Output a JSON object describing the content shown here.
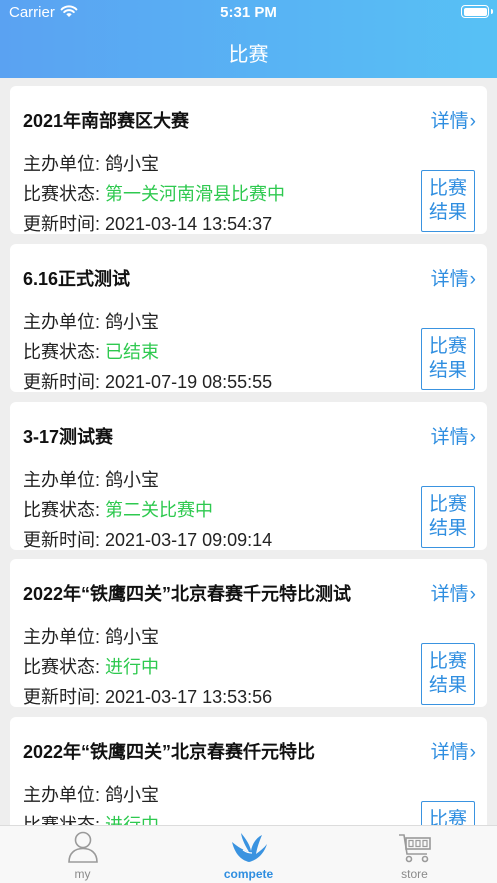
{
  "status_bar": {
    "carrier": "Carrier",
    "time": "5:31 PM"
  },
  "nav": {
    "title": "比赛"
  },
  "labels": {
    "organizer": "主办单位: ",
    "status": "比赛状态: ",
    "updated": "更新时间: ",
    "details": "详情",
    "result_line1": "比赛",
    "result_line2": "结果"
  },
  "competitions": [
    {
      "title": "2021年南部赛区大赛",
      "organizer": "鸽小宝",
      "status": "第一关河南滑县比赛中",
      "updated": "2021-03-14 13:54:37"
    },
    {
      "title": "6.16正式测试",
      "organizer": "鸽小宝",
      "status": "已结束",
      "updated": "2021-07-19 08:55:55"
    },
    {
      "title": "3-17测试赛",
      "organizer": "鸽小宝",
      "status": "第二关比赛中",
      "updated": "2021-03-17 09:09:14"
    },
    {
      "title": "2022年“铁鹰四关”北京春赛千元特比测试",
      "organizer": "鸽小宝",
      "status": "进行中",
      "updated": "2021-03-17 13:53:56"
    },
    {
      "title": "2022年“铁鹰四关”北京春赛仟元特比",
      "organizer": "鸽小宝",
      "status": "进行中",
      "updated": ""
    }
  ],
  "tabs": [
    {
      "label": "my",
      "icon": "person-icon",
      "active": false
    },
    {
      "label": "compete",
      "icon": "pigeon-wings-icon",
      "active": true
    },
    {
      "label": "store",
      "icon": "shopping-cart-icon",
      "active": false
    }
  ],
  "colors": {
    "header_start": "#5aa2f2",
    "header_end": "#57c1f5",
    "accent": "#2f8ee0",
    "status_green": "#2ec94f"
  }
}
